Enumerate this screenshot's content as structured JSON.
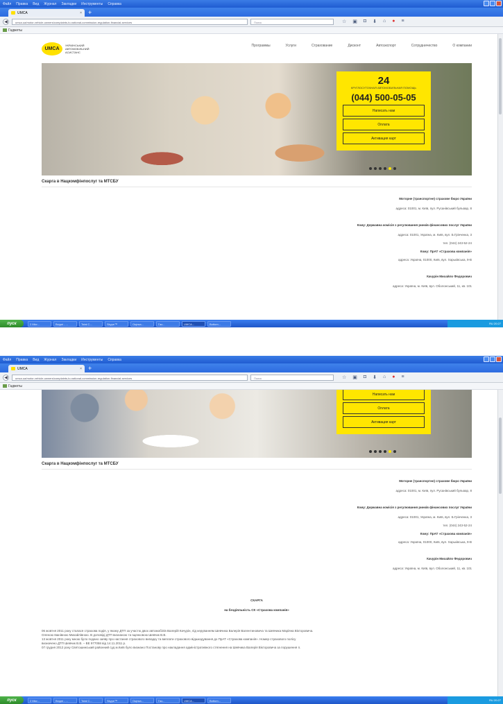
{
  "browser": {
    "menu": [
      "Файл",
      "Правка",
      "Вид",
      "Журнал",
      "Закладки",
      "Инструменты",
      "Справка"
    ],
    "tab_title": "UMCA",
    "url": "umca.ua/motor-vehicle-owners/complaints-to-national-commission-regulation-financial-services",
    "search_placeholder": "Поиск",
    "bookmark": "Гаджеты",
    "toolbar_icons": [
      "star-icon",
      "clipboard-icon",
      "pocket-icon",
      "download-icon",
      "home-icon",
      "abp-icon",
      "menu-icon"
    ]
  },
  "site": {
    "logo": "UMCA",
    "logo_text": [
      "УКРАЇНСЬКИЙ",
      "АВТОМОБІЛЬНИЙ",
      "АСИСТАНС"
    ],
    "nav": [
      "Программы",
      "Услуги",
      "Страхование",
      "Дисконт",
      "Автоэкспорт",
      "Сотрудничество",
      "О компании"
    ],
    "callbox": {
      "badge": "24",
      "subtitle": "КРУГЛОСУТОЧНАЯ АВТОМОБИЛЬНАЯ ПОМОЩЬ",
      "phone": "(044) 500-05-05",
      "buttons": [
        "Написать нам",
        "Оплата",
        "Активация карт"
      ]
    },
    "heading": "Скарга в Нацкомфінпослуг та МТСБУ",
    "recipients": [
      {
        "label": "Моторне (транспортне) страхове бюро України",
        "address": "адреса: 01001, м. Київ, пул. Русанівський бульвар, 8"
      },
      {
        "label": "Кому: Державна комісія з регулювання ринків фінансових послуг України",
        "address": "адреса: 01001, Україна, м. Київ, вул. Б.Грінченка, 3",
        "phone": "тел. (044) 243-52-24"
      },
      {
        "label": "Кому: ПрАТ «Страхова компанія»",
        "address": "адреса: Україна, 01000, Київ, вул. Харьківська, 9-В"
      },
      {
        "label": "Качурін Михайло Федорович",
        "address": "адреса: Україна, м. Київ, вул. Оболонський, 11, кв. 101"
      }
    ],
    "complaint_title": "СКАРГА",
    "complaint_subtitle": "на бездіяльність СК «Страхова компанія»",
    "complaint_text": [
      "06 жовтня 2011 року сталася страхова подія, у якому ДТП за участю двох автомобілів Валерій Качурін, під керуванням Шевчика Валерія Валентиновича та Шевчика Маріяна Вікторовича.",
      "Оленою Іванівною Михайлівною. В доповіді ДТП визнаною та Іщенковою Шевчик В.В.",
      "13 жовтня 2011 року мною було подано заяву про настання страхового випадку та виплати страхового відшкодування до ПрАТ «Страхова компанія». Номер страхового полісу",
      "визначено ДТП Шевчик В.В. – ВЕ 977058 від 14.11.2011 р.",
      "07 грудня 2012 року Святошинський районний суд м.Київ було визнано Постанову про накладання адміністративного стягнення на Шевчика Валерія Вікторовича за порушення п."
    ]
  },
  "taskbar": {
    "start": "пуск",
    "tasks": [
      "2 Micr...",
      "Вхідні - ...",
      "Total C...",
      "Skype™",
      "Оцінка...",
      "Газ...",
      "UMCA...",
      "Bottom..."
    ],
    "tray": "RU 20:27"
  }
}
